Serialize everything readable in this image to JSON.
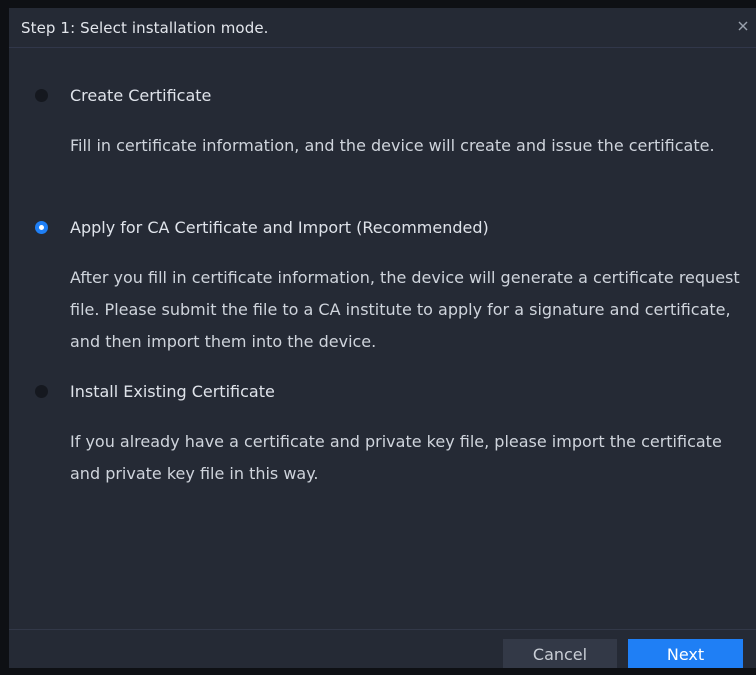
{
  "dialog": {
    "title": "Step 1: Select installation mode.",
    "close_icon": "close-icon"
  },
  "options": [
    {
      "label": "Create Certificate",
      "description": "Fill in certificate information, and the device will create and issue the certificate.",
      "selected": false
    },
    {
      "label": "Apply for CA Certificate and Import (Recommended)",
      "description": "After you fill in certificate information, the device will generate a certificate request file. Please submit the file to a CA institute to apply for a signature and certificate, and then import them into the device.",
      "selected": true
    },
    {
      "label": "Install Existing Certificate",
      "description": "If you already have a certificate and private key file, please import the certificate and private key file in this way.",
      "selected": false
    }
  ],
  "footer": {
    "cancel_label": "Cancel",
    "next_label": "Next"
  },
  "colors": {
    "accent": "#1f7ff5",
    "dialog_bg": "#252a35",
    "text": "#dfe3ea"
  }
}
